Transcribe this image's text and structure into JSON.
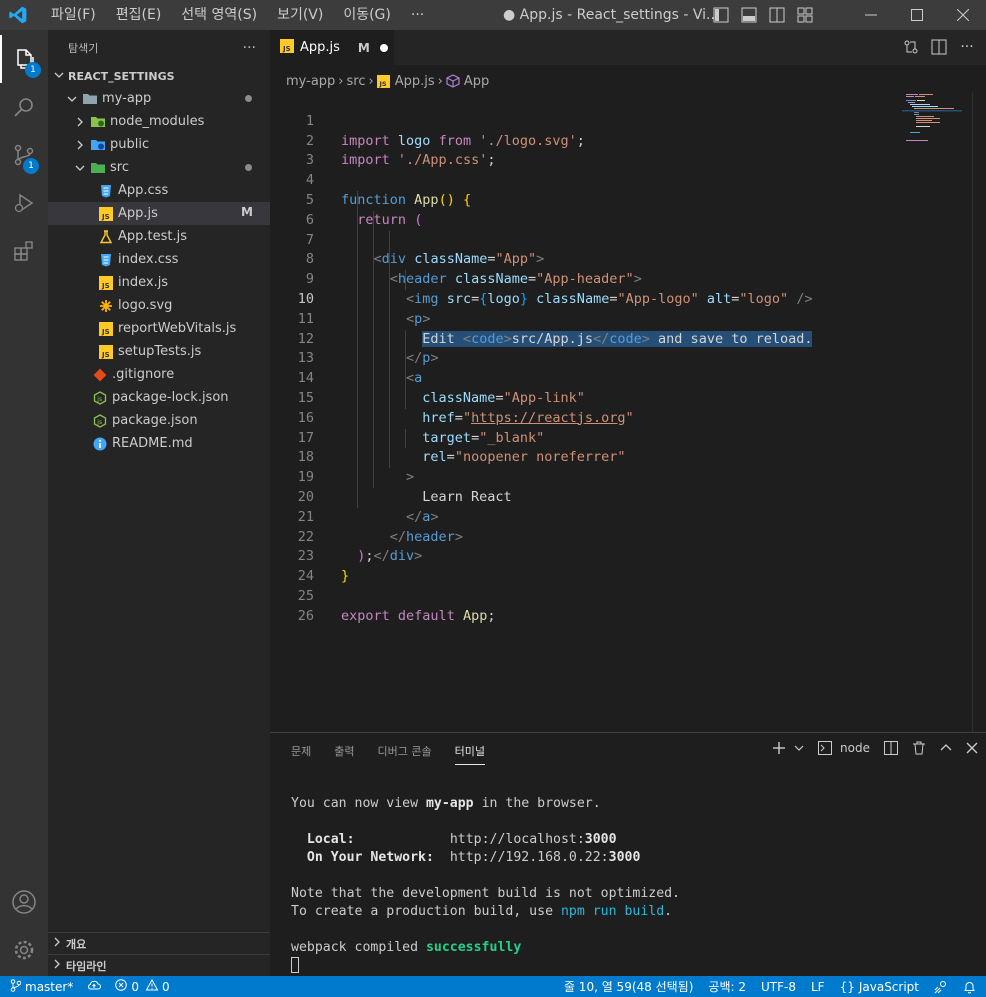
{
  "titlebar": {
    "menu": [
      "파일(F)",
      "편집(E)",
      "선택 영역(S)",
      "보기(V)",
      "이동(G)",
      "···"
    ],
    "title": "● App.js - React_settings - Vi..."
  },
  "activity": {
    "explorer_badge": "1",
    "scm_badge": "1"
  },
  "sidebar": {
    "header": "탐색기",
    "more": "···",
    "project": "REACT_SETTINGS",
    "tree": [
      {
        "label": "my-app"
      },
      {
        "label": "node_modules"
      },
      {
        "label": "public"
      },
      {
        "label": "src"
      },
      {
        "label": "App.css"
      },
      {
        "label": "App.js",
        "status": "M"
      },
      {
        "label": "App.test.js"
      },
      {
        "label": "index.css"
      },
      {
        "label": "index.js"
      },
      {
        "label": "logo.svg"
      },
      {
        "label": "reportWebVitals.js"
      },
      {
        "label": "setupTests.js"
      },
      {
        "label": ".gitignore"
      },
      {
        "label": "package-lock.json"
      },
      {
        "label": "package.json"
      },
      {
        "label": "README.md"
      }
    ],
    "outline": "개요",
    "timeline": "타임라인"
  },
  "tab": {
    "label": "App.js",
    "status": "M"
  },
  "breadcrumb": [
    "my-app",
    "src",
    "App.js",
    "App"
  ],
  "editor": {
    "line_numbers": [
      "1",
      "2",
      "3",
      "4",
      "5",
      "6",
      "7",
      "8",
      "9",
      "10",
      "11",
      "12",
      "13",
      "14",
      "15",
      "16",
      "17",
      "18",
      "19",
      "20",
      "21",
      "22",
      "23",
      "24",
      "25",
      "26"
    ],
    "import_kw": "import",
    "from_kw": "from",
    "logo_ident": "logo",
    "logo_path": "'./logo.svg'",
    "css_path": "'./App.css'",
    "function_kw": "function",
    "app_fn": "App",
    "return_kw": "return",
    "div_tag": "div",
    "classname_attr": "className",
    "app_class": "\"App\"",
    "header_tag": "header",
    "header_class": "\"App-header\"",
    "img_tag": "img",
    "src_attr": "src",
    "logo_class": "\"App-logo\"",
    "alt_attr": "alt",
    "alt_value": "\"logo\"",
    "p_tag": "p",
    "edit_text": "Edit ",
    "code_tag": "code",
    "code_text": "src/App.js",
    "save_text": " and save to reload.",
    "a_tag": "a",
    "link_class": "\"App-link\"",
    "href_attr": "href",
    "href_value": "https://reactjs.org",
    "target_attr": "target",
    "target_value": "\"_blank\"",
    "rel_attr": "rel",
    "rel_value": "\"noopener noreferrer\"",
    "learn_text": "Learn React",
    "export_kw": "export",
    "default_kw": "default"
  },
  "panel": {
    "tabs": [
      "문제",
      "출력",
      "디버그 콘솔",
      "터미널"
    ],
    "active_tab": "터미널",
    "shell": "node",
    "terminal": {
      "l1a": "You can now view ",
      "l1b": "my-app",
      "l1c": " in the browser.",
      "local_label": "Local:",
      "local_url": "http://localhost:",
      "local_port": "3000",
      "network_label": "On Your Network:",
      "network_url": "http://192.168.0.22:",
      "network_port": "3000",
      "note1": "Note that the development build is not optimized.",
      "note2a": "To create a production build, use ",
      "note2b": "npm run build",
      "note2c": ".",
      "compiled_a": "webpack compiled ",
      "compiled_b": "successfully"
    }
  },
  "statusbar": {
    "branch": "master*",
    "errors": "0",
    "warnings": "0",
    "position": "줄 10, 열 59(48 선택됨)",
    "spaces": "공백: 2",
    "encoding": "UTF-8",
    "eol": "LF",
    "language": "JavaScript"
  },
  "colors": {
    "accent": "#007acc",
    "selection": "#264f78"
  }
}
